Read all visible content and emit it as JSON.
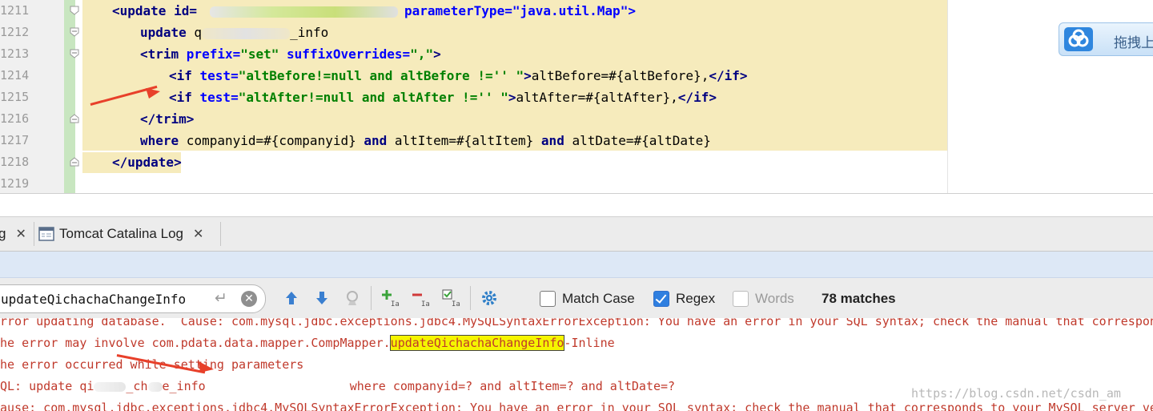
{
  "editor": {
    "line_numbers": [
      "1211",
      "1212",
      "1213",
      "1214",
      "1215",
      "1216",
      "1217",
      "1218",
      "1219"
    ],
    "lines": {
      "l1211": {
        "open": "<update id=",
        "rest": "parameterType=\"java.util.Map\">"
      },
      "l1212": {
        "kw": "update",
        "pre": " q",
        "post": "_info"
      },
      "l1213": {
        "tag": "<trim ",
        "a1": "prefix=",
        "v1": "\"set\"",
        "a2": " suffixOverrides=",
        "v2": "\",\"",
        "close": ">"
      },
      "l1214": {
        "tag": "<if ",
        "a": "test=",
        "v": "\"altBefore!=null and altBefore !='' \"",
        "close": ">",
        "body": "altBefore=#{altBefore},",
        "end": "</if>"
      },
      "l1215": {
        "tag": "<if ",
        "a": "test=",
        "v": "\"altAfter!=null and altAfter !='' \"",
        "close": ">",
        "body": "altAfter=#{altAfter},",
        "end": "</if>"
      },
      "l1216": {
        "end": "</trim>"
      },
      "l1217": {
        "kw1": "where",
        "t1": " companyid=#{companyid} ",
        "kw2": "and",
        "t2": " altItem=#{altItem} ",
        "kw3": "and",
        "t3": " altDate=#{altDate}"
      },
      "l1218": {
        "end": "</update>"
      }
    }
  },
  "widget": {
    "label": "拖拽上"
  },
  "tabs": [
    {
      "label": "g"
    },
    {
      "label": "Tomcat Catalina Log"
    }
  ],
  "search": {
    "query": "updateQichachaChangeInfo",
    "match_case_label": "Match Case",
    "regex_label": "Regex",
    "words_label": "Words",
    "match_case_checked": false,
    "regex_checked": true,
    "words_checked": false,
    "matches_label": "78 matches"
  },
  "console": {
    "line1": "rror updating database.  Cause: com.mysql.jdbc.exceptions.jdbc4.MySQLSyntaxErrorException: You have an error in your SQL syntax; check the manual that correspon",
    "line2_pre": "he error may involve com.pdata.data.mapper.CompMapper.",
    "line2_match": "updateQichachaChangeInfo",
    "line2_post": "-Inline",
    "line3": "he error occurred while setting parameters",
    "line4_pre": "QL: update qi",
    "line4_mid": "_ch",
    "line4_post": "e_info",
    "line4_where": "where companyid=? and altItem=? and altDate=?",
    "line5": "ause: com.mysql.jdbc.exceptions.jdbc4.MySQLSyntaxErrorException: You have an error in your SQL syntax; check the manual that corresponds to your MySQL server ve",
    "watermark": "https://blog.csdn.net/csdn_am"
  },
  "colors": {
    "highlight": "#f6ebbc",
    "error_text": "#c0392b",
    "match_bg": "#f5f500",
    "annotation_arrow": "#e8402a"
  }
}
